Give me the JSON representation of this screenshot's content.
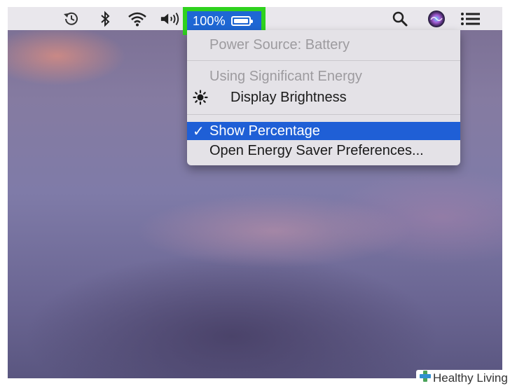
{
  "menubar": {
    "icons": [
      "time-machine-icon",
      "bluetooth-icon",
      "wifi-icon",
      "volume-icon",
      "spotlight-search-icon",
      "siri-icon",
      "notification-center-icon"
    ],
    "battery": {
      "percentage": "100%",
      "level": 1.0
    }
  },
  "battery_menu": {
    "power_source": "Power Source: Battery",
    "significant_energy_heading": "Using Significant Energy",
    "display_brightness": "Display Brightness",
    "show_percentage": "Show Percentage",
    "show_percentage_checked": true,
    "open_energy_saver": "Open Energy Saver Preferences..."
  },
  "colors": {
    "highlight": "#2fd21e",
    "selection": "#1f5fd6"
  },
  "watermark": {
    "text": "Healthy Living"
  }
}
